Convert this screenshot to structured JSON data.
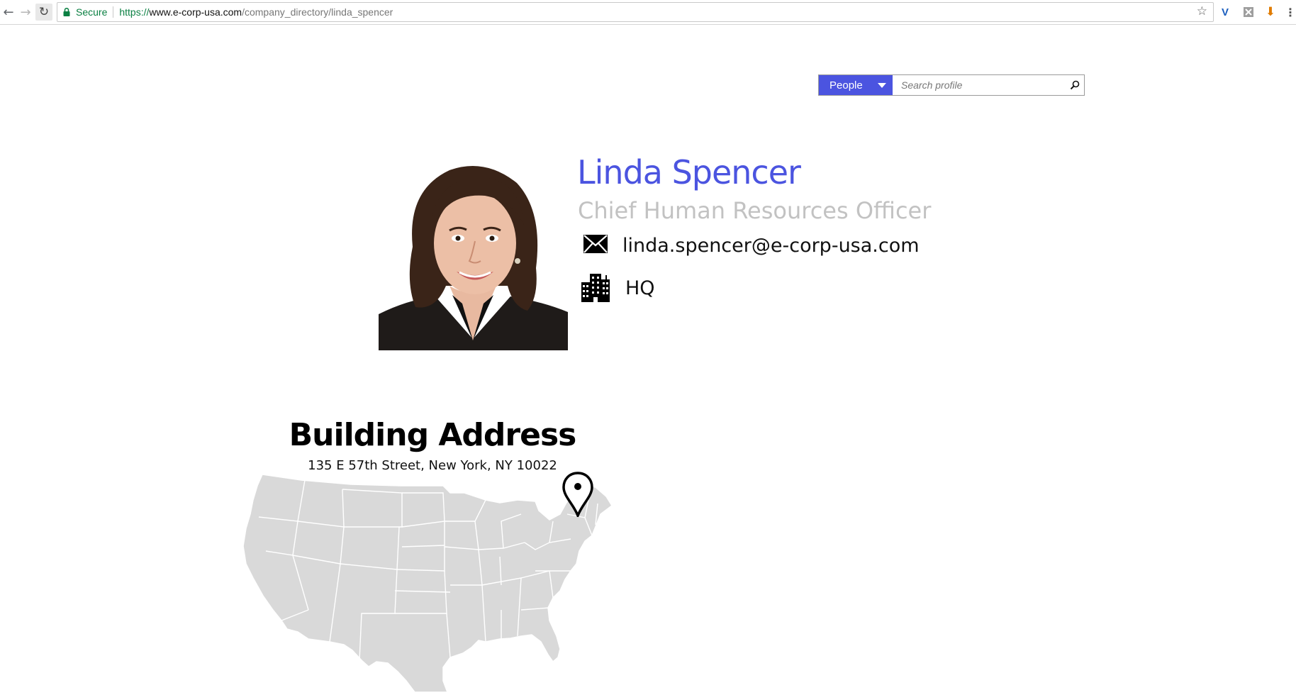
{
  "browser": {
    "secure_label": "Secure",
    "url_scheme": "https://",
    "url_host": "www.e-corp-usa.com",
    "url_path": "/company_directory/linda_spencer",
    "accent_secure": "#0b8043"
  },
  "search": {
    "scope_label": "People",
    "placeholder": "Search profile",
    "accent": "#4b54e0"
  },
  "profile": {
    "name": "Linda Spencer",
    "title": "Chief Human Resources Officer",
    "email": "linda.spencer@e-corp-usa.com",
    "office": "HQ",
    "name_color": "#4b54e0",
    "title_color": "#c2c2c2"
  },
  "building": {
    "heading": "Building Address",
    "address": "135 E 57th Street, New York, NY 10022"
  },
  "icons": [
    "back-icon",
    "forward-icon",
    "reload-icon",
    "lock-icon",
    "star-icon",
    "envelope-icon",
    "buildings-icon",
    "search-icon",
    "map-pin-icon"
  ]
}
